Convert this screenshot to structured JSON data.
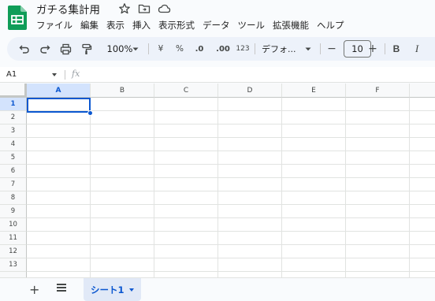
{
  "header": {
    "title": "ガチる集計用",
    "icons": [
      "star-icon",
      "move-to-folder-icon",
      "cloud-status-icon"
    ]
  },
  "menubar": {
    "items": [
      "ファイル",
      "編集",
      "表示",
      "挿入",
      "表示形式",
      "データ",
      "ツール",
      "拡張機能",
      "ヘルプ"
    ]
  },
  "toolbar": {
    "zoom": "100%",
    "currency": "¥",
    "percent": "%",
    "decrease_decimal": ".0",
    "increase_decimal": ".00",
    "number_format": "123",
    "font": "デフォ...",
    "font_size": "10",
    "minus": "−",
    "plus": "+",
    "bold": "B",
    "italic": "I"
  },
  "formula_bar": {
    "cell_ref": "A1",
    "fx": "fx",
    "value": ""
  },
  "grid": {
    "columns": [
      "A",
      "B",
      "C",
      "D",
      "E",
      "F"
    ],
    "rows": [
      "1",
      "2",
      "3",
      "4",
      "5",
      "6",
      "7",
      "8",
      "9",
      "10",
      "11",
      "12",
      "13"
    ],
    "selected_cell": "A1"
  },
  "sheets": {
    "active": "シート1"
  },
  "colors": {
    "accent": "#0b57d0",
    "toolbar_bg": "#edf2fa",
    "logo_green": "#0f9d58"
  }
}
